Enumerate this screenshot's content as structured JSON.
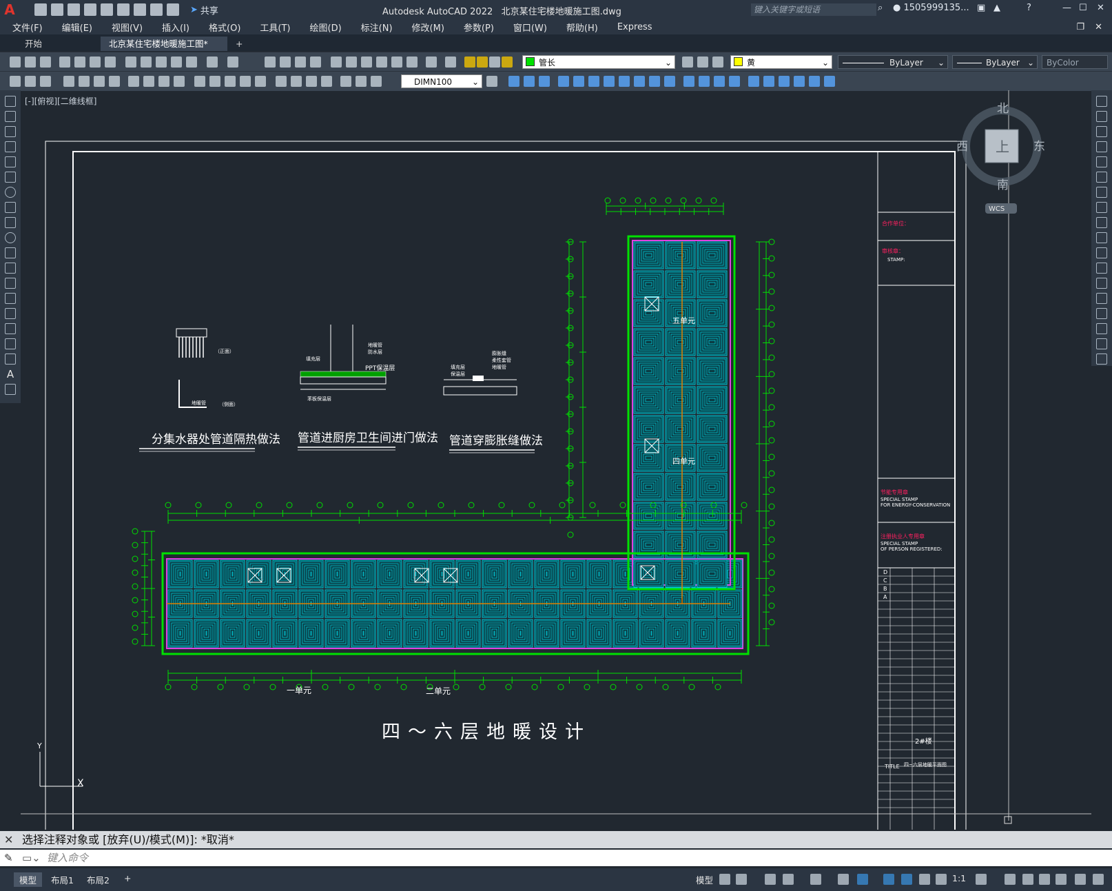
{
  "app": {
    "title": "Autodesk AutoCAD 2022",
    "file": "北京某住宅楼地暖施工图.dwg",
    "share": "共享",
    "search_placeholder": "键入关键字或短语",
    "user": "1505999135..."
  },
  "menu": [
    "文件(F)",
    "编辑(E)",
    "视图(V)",
    "插入(I)",
    "格式(O)",
    "工具(T)",
    "绘图(D)",
    "标注(N)",
    "修改(M)",
    "参数(P)",
    "窗口(W)",
    "帮助(H)",
    "Express"
  ],
  "tabs": {
    "start": "开始",
    "active": "北京某住宅楼地暖施工图*",
    "add": "+"
  },
  "toolbar": {
    "layer": "管长",
    "color": "黄",
    "linetype": "ByLayer",
    "lineweight": "ByLayer",
    "plotstyle": "ByColor",
    "dimstyle": "DIMN100"
  },
  "viewport": {
    "label": "[-][俯视][二维线框]",
    "compass": {
      "north": "北",
      "south": "南",
      "east": "东",
      "west": "西",
      "top": "上",
      "wcs": "WCS"
    }
  },
  "drawing": {
    "detail1_label": "分集水器处管道隔热做法",
    "detail2_label": "管道进厨房卫生间进门做法",
    "detail3_label": "管道穿膨胀缝做法",
    "detail1_front": "（正面）",
    "detail1_side": "（侧面）",
    "detail1_pipe": "地暖管",
    "detail2_ppt": "PPT保温层",
    "detail2_a": "填充层",
    "detail2_b": "地暖管",
    "detail2_c": "防水层",
    "detail2_d": "苯板保温层",
    "detail3_a": "膨胀缝",
    "detail3_b": "柔性套管",
    "detail3_c": "地暖管",
    "detail3_d": "填充层",
    "detail3_e": "保温层",
    "unit1": "一单元",
    "unit2": "二单元",
    "unit4": "四单元",
    "unit5": "五单元",
    "main_title": "四～六层地暖设计"
  },
  "titleblock": {
    "cooperation": "合作单位：",
    "approval": "审核章：",
    "stamp": "STAMP:",
    "energy_cn": "节能专用章",
    "energy_en1": "SPECIAL STAMP",
    "energy_en2": "FOR ENERGY-CONSERVATION",
    "registered_cn": "注册执业人专用章",
    "registered_en1": "SPECIAL STAMP",
    "registered_en2": "OF PERSON REGISTERED:",
    "rev_rows": [
      "D",
      "C",
      "B",
      "A"
    ],
    "project_name": "2#楼",
    "title_label": "TITLE",
    "drawing_name": "四~六层地暖平面图"
  },
  "command": {
    "history": "选择注释对象或 [放弃(U)/模式(M)]: *取消*",
    "placeholder": "键入命令"
  },
  "status": {
    "tabs": [
      "模型",
      "布局1",
      "布局2"
    ],
    "add": "+",
    "model_label": "模型",
    "scale": "1:1"
  },
  "colors": {
    "background": "#212830",
    "cyan": "#00c8d8",
    "green": "#00e000",
    "magenta": "#e040e0",
    "white": "#ffffff",
    "orange": "#e08000",
    "red_title": "#ff2060"
  }
}
